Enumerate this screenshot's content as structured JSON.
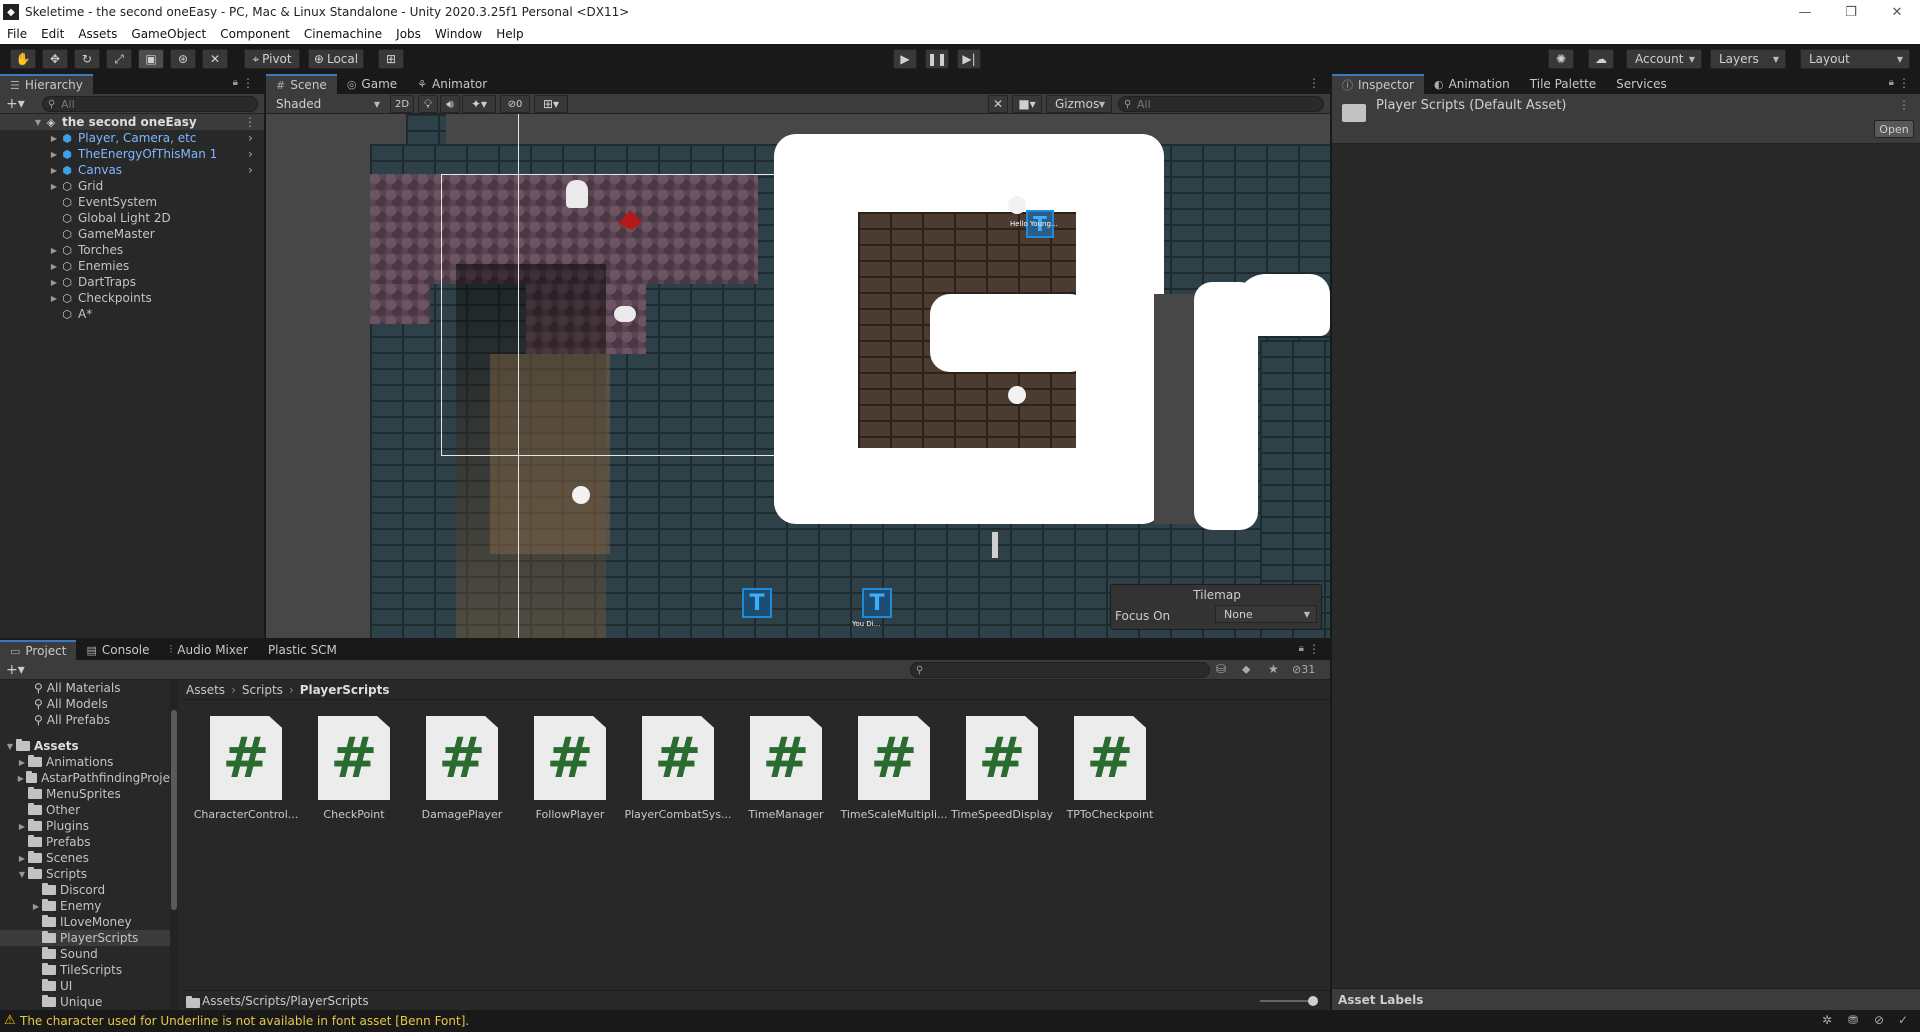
{
  "window": {
    "title": "Skeletime - the second oneEasy - PC, Mac & Linux Standalone - Unity 2020.3.25f1 Personal <DX11>",
    "controls": [
      "—",
      "❐",
      "✕"
    ]
  },
  "menu": [
    "File",
    "Edit",
    "Assets",
    "GameObject",
    "Component",
    "Cinemachine",
    "Jobs",
    "Window",
    "Help"
  ],
  "toolbar": {
    "pivot": "Pivot",
    "local": "Local",
    "account": "Account",
    "layers": "Layers",
    "layout": "Layout"
  },
  "hierarchy": {
    "tab": "Hierarchy",
    "search_placeholder": "All",
    "scene_name": "the second oneEasy",
    "items": [
      {
        "label": "Player, Camera, etc",
        "prefab": true,
        "arrow": true
      },
      {
        "label": "TheEnergyOfThisMan 1",
        "prefab": true,
        "arrow": true
      },
      {
        "label": "Canvas",
        "prefab": true,
        "arrow": true
      },
      {
        "label": "Grid",
        "prefab": false,
        "arrow": true
      },
      {
        "label": "EventSystem",
        "prefab": false,
        "arrow": false
      },
      {
        "label": "Global Light 2D",
        "prefab": false,
        "arrow": false
      },
      {
        "label": "GameMaster",
        "prefab": false,
        "arrow": false
      },
      {
        "label": "Torches",
        "prefab": false,
        "arrow": true
      },
      {
        "label": "Enemies",
        "prefab": false,
        "arrow": true
      },
      {
        "label": "DartTraps",
        "prefab": false,
        "arrow": true
      },
      {
        "label": "Checkpoints",
        "prefab": false,
        "arrow": true
      },
      {
        "label": "A*",
        "prefab": false,
        "arrow": false
      }
    ]
  },
  "scene": {
    "tabs": [
      "Scene",
      "Game",
      "Animator"
    ],
    "shading": "Shaded",
    "mode_2d": "2D",
    "hidden_count": "0",
    "gizmos": "Gizmos",
    "search_placeholder": "All",
    "overlay_big_text": "Br",
    "tilemap_overlay": {
      "title": "Tilemap",
      "focus_label": "Focus On",
      "focus_value": "None"
    },
    "sprite_texts": [
      "Hello Young...",
      "You Di..."
    ]
  },
  "inspector": {
    "tabs": [
      "Inspector",
      "Animation",
      "Tile Palette",
      "Services"
    ],
    "asset_title": "Player Scripts (Default Asset)",
    "open_button": "Open",
    "asset_labels": "Asset Labels"
  },
  "project": {
    "tabs": [
      "Project",
      "Console",
      "Audio Mixer",
      "Plastic SCM"
    ],
    "favorites": [
      "All Materials",
      "All Models",
      "All Prefabs"
    ],
    "root": "Assets",
    "folders": [
      {
        "label": "Animations",
        "depth": 1,
        "arrow": true
      },
      {
        "label": "AstarPathfindingProje",
        "depth": 1,
        "arrow": true
      },
      {
        "label": "MenuSprites",
        "depth": 1,
        "arrow": false
      },
      {
        "label": "Other",
        "depth": 1,
        "arrow": false
      },
      {
        "label": "Plugins",
        "depth": 1,
        "arrow": true
      },
      {
        "label": "Prefabs",
        "depth": 1,
        "arrow": false
      },
      {
        "label": "Scenes",
        "depth": 1,
        "arrow": true
      },
      {
        "label": "Scripts",
        "depth": 1,
        "arrow": "open"
      },
      {
        "label": "Discord",
        "depth": 2,
        "arrow": false
      },
      {
        "label": "Enemy",
        "depth": 2,
        "arrow": true
      },
      {
        "label": "ILoveMoney",
        "depth": 2,
        "arrow": false
      },
      {
        "label": "PlayerScripts",
        "depth": 2,
        "arrow": false,
        "selected": true
      },
      {
        "label": "Sound",
        "depth": 2,
        "arrow": false
      },
      {
        "label": "TileScripts",
        "depth": 2,
        "arrow": false
      },
      {
        "label": "UI",
        "depth": 2,
        "arrow": false
      },
      {
        "label": "Unique",
        "depth": 2,
        "arrow": false
      }
    ],
    "breadcrumb": [
      "Assets",
      "Scripts",
      "PlayerScripts"
    ],
    "hidden_count": "31",
    "assets": [
      "CharacterControl...",
      "CheckPoint",
      "DamagePlayer",
      "FollowPlayer",
      "PlayerCombatSys...",
      "TimeManager",
      "TimeScaleMultipli...",
      "TimeSpeedDisplay",
      "TPToCheckpoint"
    ],
    "path": "Assets/Scripts/PlayerScripts"
  },
  "status": {
    "message": "The character used for Underline is not available in font asset [Benn Font]."
  }
}
